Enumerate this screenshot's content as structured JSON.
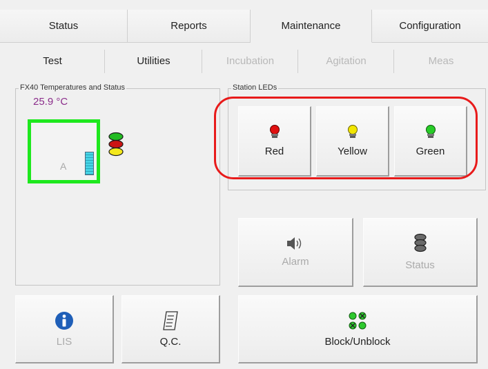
{
  "main_tabs": [
    {
      "label": "Status",
      "active": false
    },
    {
      "label": "Reports",
      "active": false
    },
    {
      "label": "Maintenance",
      "active": true
    },
    {
      "label": "Configuration",
      "active": false
    }
  ],
  "sub_tabs": [
    {
      "label": "Test",
      "enabled": true
    },
    {
      "label": "Utilities",
      "enabled": true
    },
    {
      "label": "Incubation",
      "enabled": false
    },
    {
      "label": "Agitation",
      "enabled": false
    },
    {
      "label": "Meas",
      "enabled": false
    }
  ],
  "fx40_panel": {
    "title": "FX40 Temperatures and Status",
    "temperature": "25.9 °C",
    "station_label": "A",
    "station_status_color": "#1ee81e"
  },
  "station_leds": {
    "title": "Station LEDs",
    "buttons": [
      {
        "label": "Red",
        "icon": "red-led-icon",
        "color": "#e01010"
      },
      {
        "label": "Yellow",
        "icon": "yellow-led-icon",
        "color": "#f2e600"
      },
      {
        "label": "Green",
        "icon": "green-led-icon",
        "color": "#28cc28"
      }
    ]
  },
  "actions": {
    "alarm_label": "Alarm",
    "status_label": "Status",
    "lis_label": "LIS",
    "qc_label": "Q.C.",
    "block_label": "Block/Unblock"
  },
  "colors": {
    "highlight": "#e81a1a",
    "temperature_text": "#8b2d8b",
    "info_icon": "#1f5fb8"
  }
}
